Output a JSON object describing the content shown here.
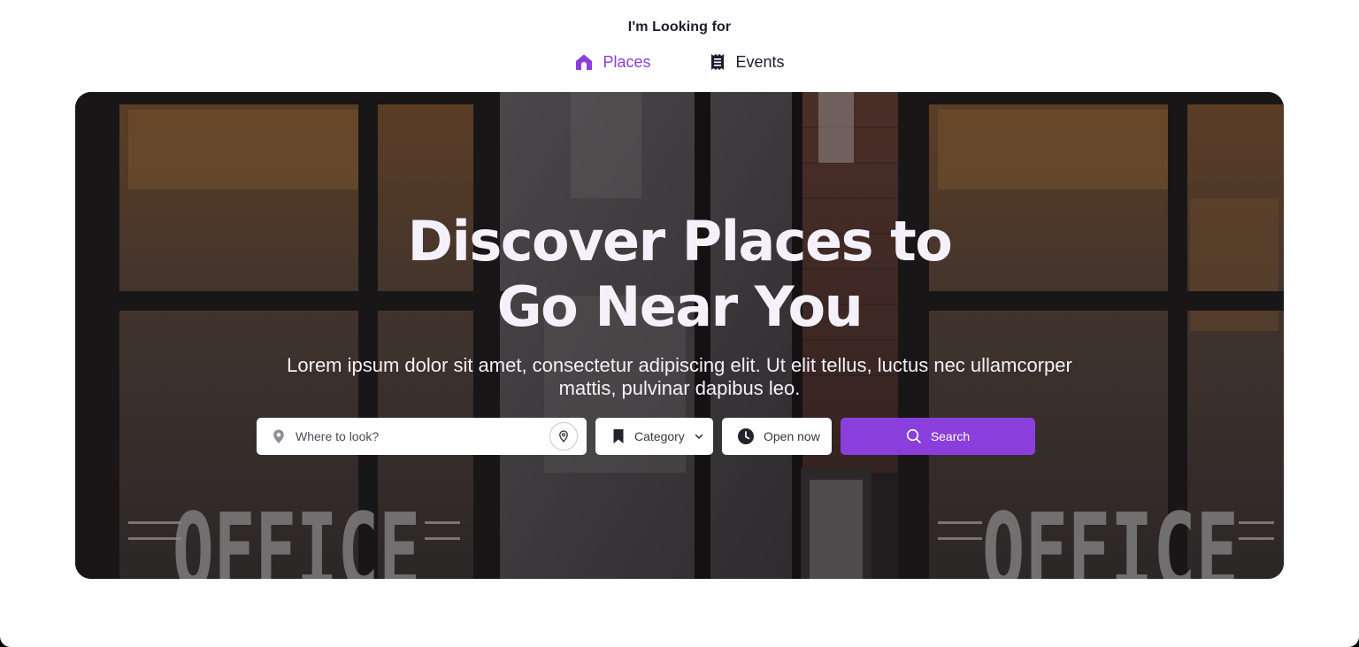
{
  "header": {
    "looking_for": "I'm Looking for",
    "tabs": [
      {
        "label": "Places",
        "icon": "home-icon",
        "active": true
      },
      {
        "label": "Events",
        "icon": "receipt-icon",
        "active": false
      }
    ]
  },
  "hero": {
    "title_line1": "Discover Places to",
    "title_line2": "Go Near You",
    "subtitle_line1": "Lorem ipsum dolor sit amet, consectetur adipiscing elit. Ut elit tellus, luctus nec ullamcorper",
    "subtitle_line2": "mattis, pulvinar dapibus leo.",
    "background_sign_text": "OFFICE"
  },
  "search": {
    "where_placeholder": "Where to look?",
    "category_label": "Category",
    "open_now_label": "Open now",
    "search_label": "Search"
  },
  "colors": {
    "accent": "#8a3fdc",
    "active_tab": "#8a3fdc",
    "text_dark": "#1e1b2e"
  }
}
